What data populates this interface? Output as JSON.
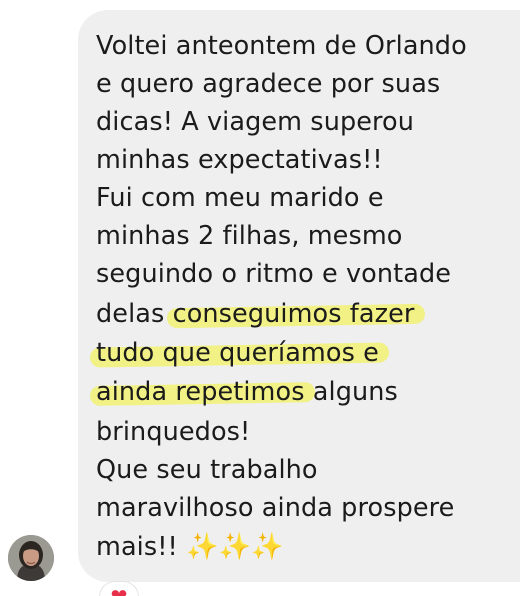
{
  "message": {
    "lines": [
      "Voltei anteontem de Orlando",
      "e quero agradece por suas",
      "dicas! A viagem superou",
      "minhas expectativas!!",
      "Fui com meu marido e",
      "minhas 2 filhas, mesmo",
      "seguindo o ritmo e vontade"
    ],
    "line8_prefix": "delas ",
    "line8_highlight": "conseguimos fazer",
    "line9_highlight": "tudo que queríamos e",
    "line10_highlight": "ainda repetimos",
    "line10_suffix": " alguns",
    "lines_after": [
      "brinquedos!",
      "Que seu trabalho",
      "maravilhoso ainda prospere"
    ],
    "last_line_text": "mais!! ",
    "sparkles": "✨✨✨",
    "highlight_color": "#f0f07e"
  },
  "reaction": {
    "emoji": "❤"
  },
  "avatar": {
    "icon": "person-avatar"
  }
}
